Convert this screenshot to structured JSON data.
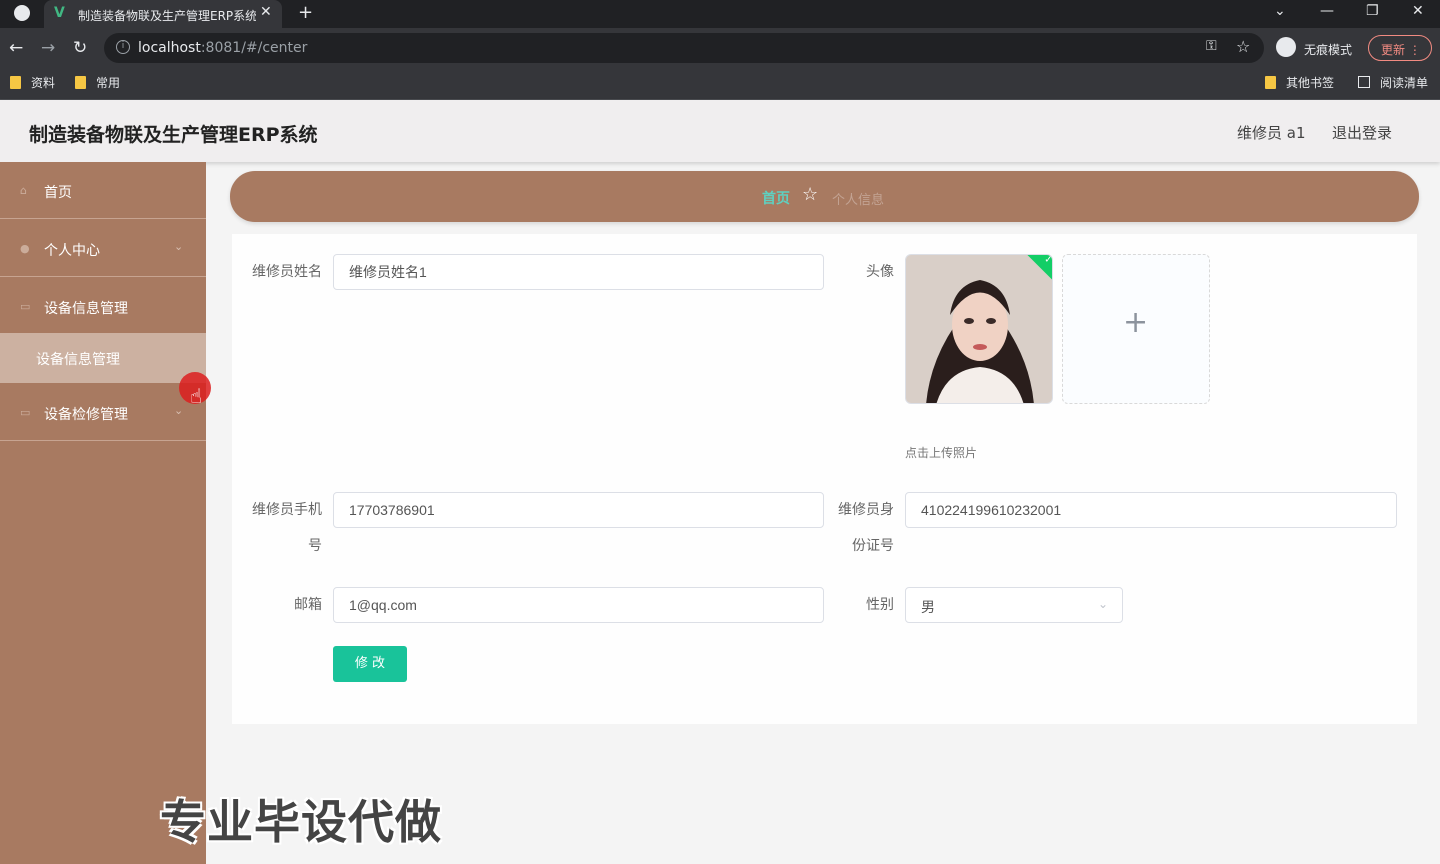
{
  "browser": {
    "tab_title": "制造装备物联及生产管理ERP系统",
    "tab_logo": "V",
    "new_tab": "+",
    "url_host": "localhost",
    "url_rest": ":8081/#/center",
    "incognito_label": "无痕模式",
    "update_label": "更新",
    "bookmarks": [
      "资料",
      "常用"
    ],
    "bookmarks_right": [
      "其他书签",
      "阅读清单"
    ]
  },
  "header": {
    "title": "制造装备物联及生产管理ERP系统",
    "user": "维修员 a1",
    "logout": "退出登录"
  },
  "sidebar": {
    "items": [
      {
        "label": "首页",
        "icon": "home-icon"
      },
      {
        "label": "个人中心",
        "icon": "user-icon"
      },
      {
        "label": "设备信息管理",
        "icon": "menu-icon"
      },
      {
        "label": "设备检修管理",
        "icon": "menu-icon"
      }
    ],
    "sub_item": "设备信息管理"
  },
  "breadcrumb": {
    "home": "首页",
    "current": "个人信息"
  },
  "form": {
    "name_label": "维修员姓名",
    "name_value": "维修员姓名1",
    "avatar_label": "头像",
    "upload_hint": "点击上传照片",
    "phone_label": "维修员手机号",
    "phone_value": "17703786901",
    "id_label": "维修员身份证号",
    "id_value": "410224199610232001",
    "email_label": "邮箱",
    "email_value": "1@qq.com",
    "gender_label": "性别",
    "gender_value": "男",
    "submit": "修 改"
  },
  "watermark": "专业毕设代做",
  "colors": {
    "sidebar": "#a87a61",
    "accent": "#19c39a",
    "breadcrumb_home": "#5fd0c0"
  }
}
